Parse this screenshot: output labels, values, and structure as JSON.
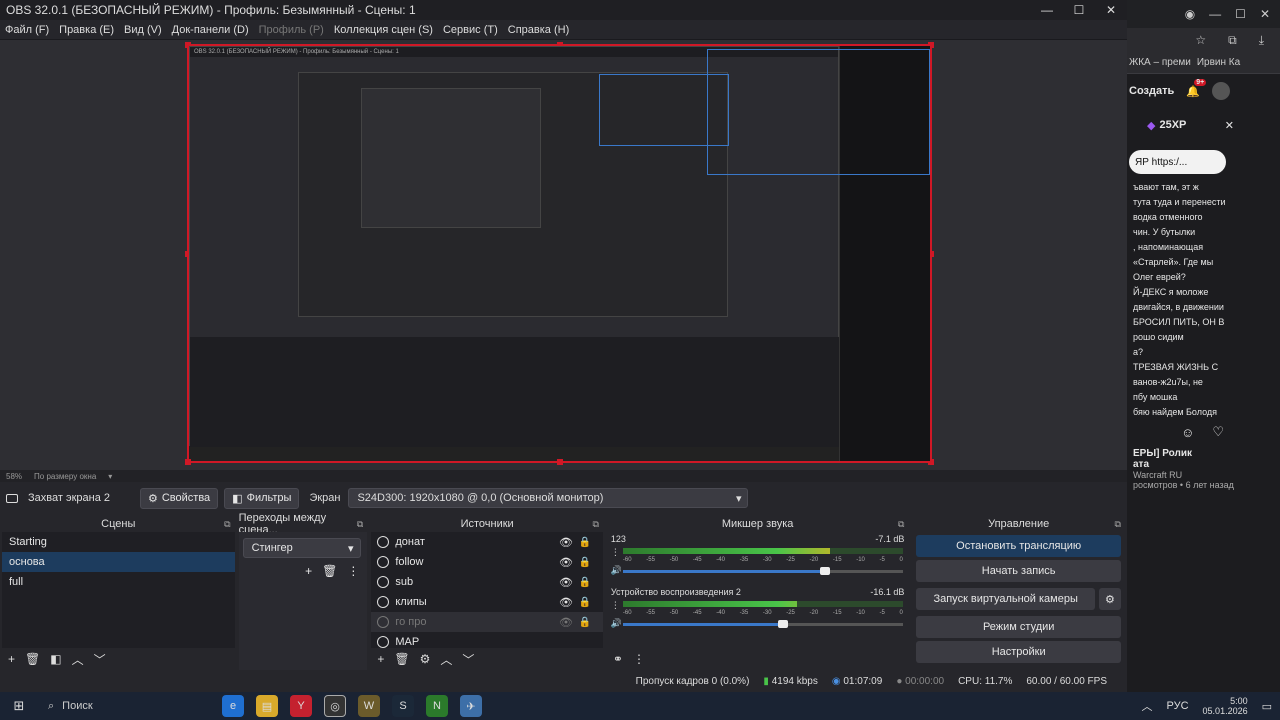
{
  "window": {
    "title": "OBS 32.0.1 (БЕЗОПАСНЫЙ РЕЖИМ) - Профиль: Безымянный - Сцены: 1",
    "min": "—",
    "max": "☐",
    "close": "✕"
  },
  "menu": [
    "Файл (F)",
    "Правка (E)",
    "Вид (V)",
    "Док-панели (D)",
    "Профиль (P)",
    "Коллекция сцен (S)",
    "Сервис (T)",
    "Справка (H)"
  ],
  "preview": {
    "zoom": "58%",
    "fit_label": "По размеру окна",
    "nested_title": "OBS 32.0.1 (БЕЗОПАСНЫЙ РЕЖИМ) - Профиль: Безымянный - Сцены: 1"
  },
  "source_bar": {
    "source_name": "Захват экрана 2",
    "properties_label": "Свойства",
    "filters_label": "Фильтры",
    "screen_label": "Экран",
    "screen_value": "S24D300: 1920x1080 @ 0,0 (Основной монитор)"
  },
  "scenes": {
    "title": "Сцены",
    "items": [
      "Starting",
      "основа",
      "full"
    ],
    "selected": 1
  },
  "transitions": {
    "title": "Переходы между сцена...",
    "value": "Стингер"
  },
  "sources": {
    "title": "Источники",
    "items": [
      {
        "name": "донат",
        "hidden": false
      },
      {
        "name": "follow",
        "hidden": false
      },
      {
        "name": "sub",
        "hidden": false
      },
      {
        "name": "клипы",
        "hidden": false
      },
      {
        "name": "го про",
        "hidden": true
      },
      {
        "name": "МАР",
        "hidden": false
      }
    ]
  },
  "mixer": {
    "title": "Микшер звука",
    "tracks": [
      {
        "name": "123",
        "db": "-7.1 dB",
        "level": 0.74,
        "volume": 0.72
      },
      {
        "name": "Устройство воспроизведения 2",
        "db": "-16.1 dB",
        "level": 0.62,
        "volume": 0.57
      }
    ],
    "ticks": [
      "-60",
      "-55",
      "-50",
      "-45",
      "-40",
      "-35",
      "-30",
      "-25",
      "-20",
      "-15",
      "-10",
      "-5",
      "0"
    ]
  },
  "controls": {
    "title": "Управление",
    "stop_stream": "Остановить трансляцию",
    "start_record": "Начать запись",
    "virtual_cam": "Запуск виртуальной камеры",
    "studio_mode": "Режим студии",
    "settings": "Настройки"
  },
  "status": {
    "dropped": "Пропуск кадров 0 (0.0%)",
    "bitrate": "4194 kbps",
    "stream_time": "01:07:09",
    "rec_time": "00:00:00",
    "cpu": "CPU: 11.7%",
    "fps": "60.00 / 60.00 FPS"
  },
  "browser": {
    "bookmark1": "ЖКА – преми",
    "bookmark2": "Ирвин Ка",
    "create": "Создать",
    "badge": "9+",
    "xp": "25XP",
    "link": "ЯР https:/...",
    "chat": [
      "ъвают там, эт ж",
      "тута туда и перенести",
      "",
      "водка отменного",
      "чин. У бутылки",
      ", напоминающая",
      "«Старлей». Где мы",
      "",
      "Олег еврей?",
      "Й-ДЕКС я моложе",
      "двигайся, в движении",
      "БРОСИЛ ПИТЬ, ОН В",
      "",
      "рошо сидим",
      "а?",
      "ТРЕЗВАЯ ЖИЗНЬ С",
      "ванов-ж2u7ы, не",
      "пбу мошка",
      "бяю найдем Болодя"
    ],
    "video_title": "ЕРЫ] Ролик",
    "video_sub": "ата",
    "channel": "Warcraft RU",
    "views": "росмотров • 6 лет назад"
  },
  "taskbar": {
    "search": "Поиск",
    "lang": "РУС",
    "time": "5:00",
    "date": "05.01.2026"
  }
}
